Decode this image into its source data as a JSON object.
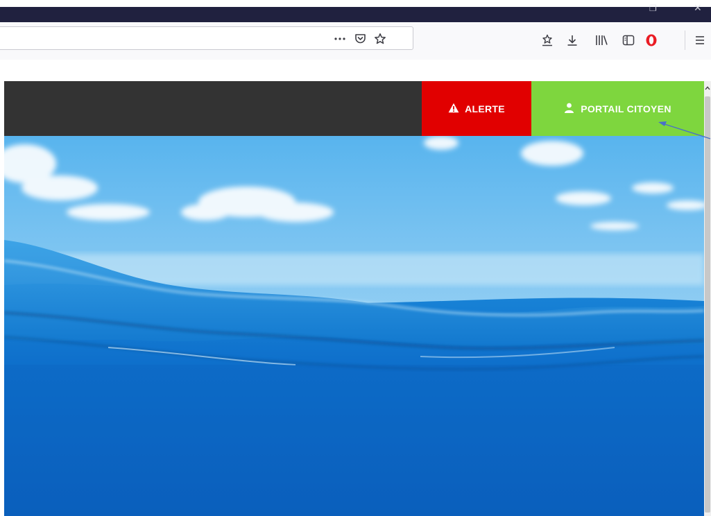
{
  "toolbar": {
    "url_value": "",
    "icons": {
      "page_actions": "more-dots-icon",
      "pocket": "pocket-icon",
      "bookmark_star": "star-icon",
      "bookmarks_menu": "bookmark-star-icon",
      "downloads": "download-icon",
      "library": "library-icon",
      "sidebar": "sidebar-icon",
      "extension": "opera-vpn-icon",
      "menu": "hamburger-icon"
    }
  },
  "site": {
    "colors": {
      "navbar": "#333333",
      "alerte": "#e10000",
      "portail": "#7ed63e"
    },
    "alerte_label": "ALERTE",
    "alerte_icon": "warning-icon",
    "portail_label": "PORTAIL CITOYEN",
    "portail_icon": "user-icon"
  },
  "annotation": {
    "icon": "arrow-icon",
    "color": "#4a6fc9"
  }
}
